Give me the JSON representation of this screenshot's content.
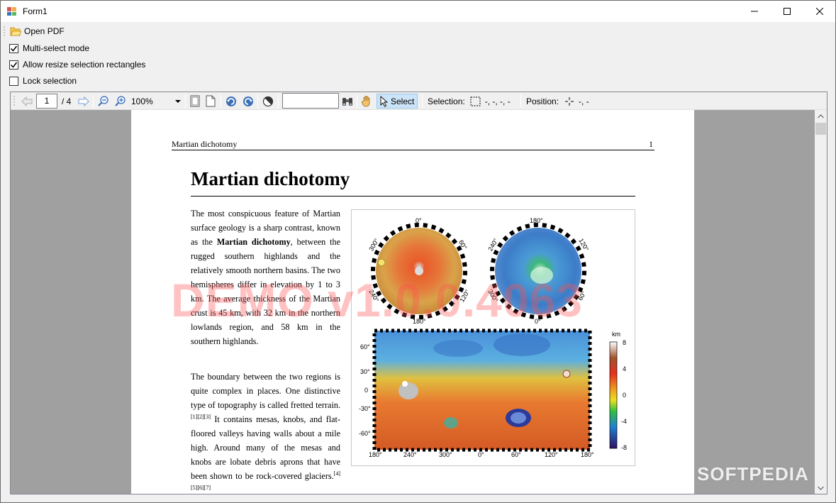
{
  "window": {
    "title": "Form1",
    "controls": {
      "minimize": "—",
      "maximize": "☐",
      "close": "✕"
    }
  },
  "toolstrip": {
    "open_pdf_label": "Open PDF",
    "open_pdf_icon": "folder-open-icon"
  },
  "options": [
    {
      "label": "Multi-select mode",
      "checked": true
    },
    {
      "label": "Allow resize selection rectangles",
      "checked": true
    },
    {
      "label": "Lock selection",
      "checked": false
    }
  ],
  "viewer_toolbar": {
    "current_page": "1",
    "page_total": "/ 4",
    "zoom": "100%",
    "search_value": "",
    "select_label": "Select",
    "selection_label": "Selection:",
    "selection_value": "-, -, -, -",
    "position_label": "Position:",
    "position_value": "-, -"
  },
  "document": {
    "running_header": "Martian dichotomy",
    "page_number": "1",
    "title": "Martian dichotomy",
    "paragraph1": {
      "pre": "The most conspicuous feature of Martian surface geology is a sharp contrast, known as the ",
      "bold": "Martian dichotomy",
      "post": ", between the rugged southern highlands and the relatively smooth northern basins. The two hemispheres differ in elevation by 1 to 3 km. The average thickness of the Martian crust is 45 km, with 32 km in the northern lowlands region, and 58 km in the southern highlands."
    },
    "paragraph2": {
      "pre": "The boundary between the two regions is quite complex in places. One distinctive type of topography is called fretted terrain.",
      "ref1": "[1][2][3]",
      "mid": " It contains mesas, knobs, and flat-floored valleys having walls about a mile high. Around many of the mesas and knobs are lobate debris aprons that have been shown to be rock-covered glaciers.",
      "ref2": "[4][5][6][7]"
    },
    "figure": {
      "north_globe_labels": {
        "top": "0°",
        "left": "300°",
        "right": "60°",
        "lower_left": "240°",
        "lower_right": "120°",
        "bottom": "180°"
      },
      "south_globe_labels": {
        "top": "180°",
        "left": "240°",
        "right": "120°",
        "lower_left": "300°",
        "lower_right": "60°",
        "bottom": "0°"
      },
      "map_lat_ticks": [
        "60°",
        "30°",
        "0",
        "-30°",
        "-60°"
      ],
      "map_lon_ticks": [
        "180°",
        "240°",
        "300°",
        "0°",
        "60°",
        "120°",
        "180°"
      ],
      "scale_unit": "km",
      "scale_ticks": [
        "8",
        "4",
        "0",
        "-4",
        "-8"
      ]
    },
    "watermark": "DEMO v1.0.0.4063"
  },
  "softpedia_mark": "SOFTPEDIA"
}
